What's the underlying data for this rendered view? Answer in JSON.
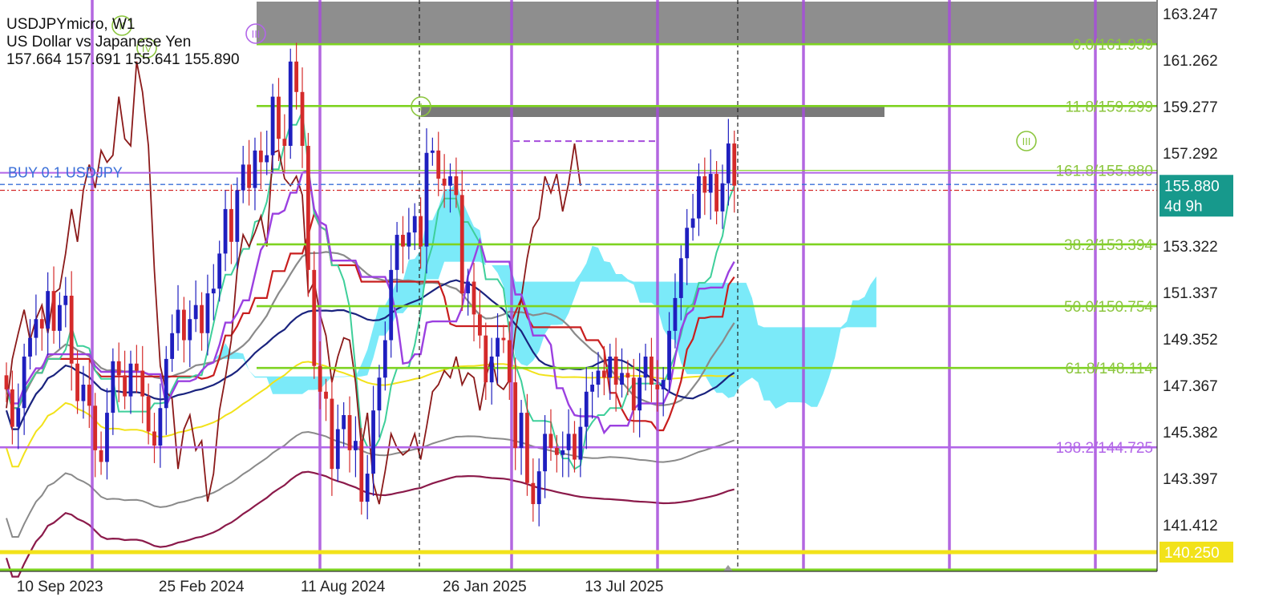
{
  "header": {
    "symbol": "USDJPYmicro, W1",
    "description": "US Dollar vs Japanese Yen",
    "ohlc": "157.664 157.691 155.641 155.890"
  },
  "colors": {
    "bull_candle": "#1f1fbf",
    "bear_candle": "#d42a2a",
    "cloud": "#4fe3f7",
    "fib_line": "#7ed321",
    "fib_label": "#8cc63f",
    "level_138": "#b266e8",
    "vertical_cycle": "#a64ddb",
    "current_price_bg": "#17998c",
    "yellow_line": "#f2e21a",
    "zone_gray": "#7a7a7a",
    "tenkan": "#3ecf9a",
    "kijun": "#8b1a1a",
    "ma_slow": "#1a237e",
    "ma_gray": "#8a8a8a"
  },
  "chart_data": {
    "type": "candlestick",
    "symbol": "USDJPYmicro",
    "timeframe": "W1",
    "ylim": [
      139.5,
      164.0
    ],
    "price_axis_ticks": [
      163.247,
      161.262,
      159.277,
      157.292,
      153.322,
      151.337,
      149.352,
      147.367,
      145.382,
      143.397,
      141.412
    ],
    "date_axis_ticks": [
      {
        "label": "10 Sep 2023",
        "week": 2
      },
      {
        "label": "25 Feb 2024",
        "week": 26
      },
      {
        "label": "11 Aug 2024",
        "week": 50
      },
      {
        "label": "26 Jan 2025",
        "week": 74
      },
      {
        "label": "13 Jul 2025",
        "week": 98
      }
    ],
    "current_price": {
      "value": 155.88,
      "countdown": "4d 9h"
    },
    "highlight_price": {
      "value": 140.25
    },
    "fibonacci_levels": [
      {
        "label": "0.0/161.939",
        "value": 161.939
      },
      {
        "label": "11.8/159.299",
        "value": 159.299
      },
      {
        "label": "161.8/155.880",
        "value": 156.55
      },
      {
        "label": "38.2/153.394",
        "value": 153.394
      },
      {
        "label": "50.0/150.754",
        "value": 150.754
      },
      {
        "label": "61.8/148.114",
        "value": 148.114
      },
      {
        "label": "138.2/144.725",
        "value": 144.725
      }
    ],
    "trade_label": "BUY 0.1 USDJPY",
    "wave_labels": [
      "II",
      "III",
      "IV",
      "I",
      "III"
    ],
    "series": [
      {
        "name": "price",
        "kind": "candles",
        "closes": [
          147.2,
          145.6,
          146.4,
          148.6,
          149.4,
          150.2,
          149.8,
          151.4,
          149.7,
          150.8,
          151.2,
          148.3,
          146.7,
          147.4,
          146.5,
          144.6,
          144.1,
          146.2,
          148.4,
          147.8,
          146.9,
          148.3,
          148.0,
          146.9,
          145.4,
          144.8,
          146.4,
          148.5,
          149.6,
          150.6,
          149.3,
          150.2,
          150.8,
          149.6,
          151.3,
          151.5,
          153.0,
          154.9,
          153.5,
          155.7,
          156.8,
          155.8,
          157.4,
          156.9,
          157.2,
          159.7,
          157.9,
          157.6,
          161.2,
          159.9,
          157.6,
          152.3,
          148.2,
          147.1,
          146.8,
          143.8,
          145.5,
          146.1,
          144.6,
          145.0,
          142.4,
          143.6,
          146.3,
          147.7,
          149.3,
          152.3,
          153.8,
          153.3,
          153.9,
          154.6,
          153.3,
          157.3,
          157.4,
          156.2,
          155.9,
          156.3,
          155.5,
          151.3,
          151.8,
          150.4,
          149.5,
          147.5,
          148.6,
          149.4,
          149.3,
          147.5,
          144.7,
          146.2,
          143.2,
          142.3,
          143.7,
          145.3,
          144.7,
          144.4,
          144.6,
          145.3,
          144.2,
          145.6,
          147.1,
          147.4,
          148.0,
          147.7,
          148.6,
          147.4,
          147.9,
          147.7,
          146.3,
          147.7,
          148.6,
          147.4,
          147.2,
          147.6,
          149.7,
          151.1,
          152.8,
          154.1,
          154.5,
          156.3,
          155.6,
          156.4,
          154.8,
          156.0,
          157.7,
          155.9
        ]
      },
      {
        "name": "ichimoku_cloud",
        "kind": "area"
      },
      {
        "name": "tenkan_sen",
        "kind": "line"
      },
      {
        "name": "kijun_sen",
        "kind": "line"
      },
      {
        "name": "moving_average_slow",
        "kind": "line"
      },
      {
        "name": "moving_average_gray",
        "kind": "line"
      }
    ]
  }
}
